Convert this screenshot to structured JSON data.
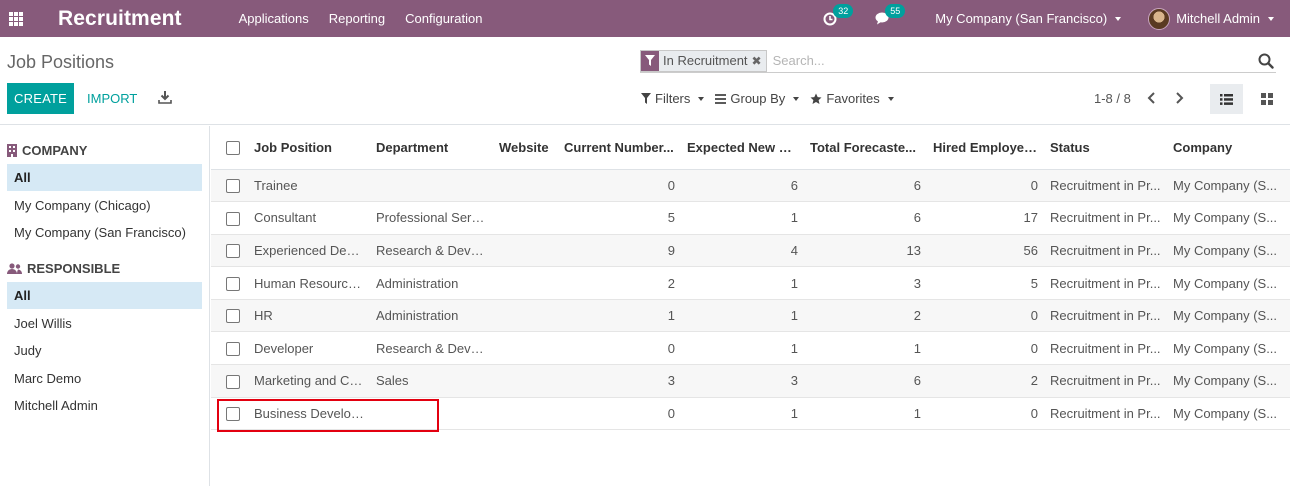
{
  "navbar": {
    "brand": "Recruitment",
    "menu": [
      "Applications",
      "Reporting",
      "Configuration"
    ],
    "activities_count": "32",
    "messages_count": "55",
    "company": "My Company (San Francisco)",
    "user": "Mitchell Admin"
  },
  "control": {
    "breadcrumb": "Job Positions",
    "facet": "In Recruitment",
    "search_placeholder": "Search...",
    "create_label": "CREATE",
    "import_label": "IMPORT",
    "filters_label": "Filters",
    "groupby_label": "Group By",
    "favorites_label": "Favorites",
    "pager": "1-8 / 8"
  },
  "sidebar": {
    "company_title": "COMPANY",
    "company_items": [
      "All",
      "My Company (Chicago)",
      "My Company (San Francisco)"
    ],
    "responsible_title": "RESPONSIBLE",
    "responsible_items": [
      "All",
      "Joel Willis",
      "Judy",
      "Marc Demo",
      "Mitchell Admin"
    ]
  },
  "table": {
    "headers": [
      "Job Position",
      "Department",
      "Website",
      "Current Number...",
      "Expected New E...",
      "Total Forecaste...",
      "Hired Employees",
      "Status",
      "Company"
    ],
    "rows": [
      [
        "Trainee",
        "",
        "",
        "0",
        "6",
        "6",
        "0",
        "Recruitment in Pr...",
        "My Company (S..."
      ],
      [
        "Consultant",
        "Professional Servi...",
        "",
        "5",
        "1",
        "6",
        "17",
        "Recruitment in Pr...",
        "My Company (S..."
      ],
      [
        "Experienced Deve...",
        "Research & Devel...",
        "",
        "9",
        "4",
        "13",
        "56",
        "Recruitment in Pr...",
        "My Company (S..."
      ],
      [
        "Human Resource...",
        "Administration",
        "",
        "2",
        "1",
        "3",
        "5",
        "Recruitment in Pr...",
        "My Company (S..."
      ],
      [
        "HR",
        "Administration",
        "",
        "1",
        "1",
        "2",
        "0",
        "Recruitment in Pr...",
        "My Company (S..."
      ],
      [
        "Developer",
        "Research & Devel...",
        "",
        "0",
        "1",
        "1",
        "0",
        "Recruitment in Pr...",
        "My Company (S..."
      ],
      [
        "Marketing and Co...",
        "Sales",
        "",
        "3",
        "3",
        "6",
        "2",
        "Recruitment in Pr...",
        "My Company (S..."
      ],
      [
        "Business Develop...",
        "",
        "",
        "0",
        "1",
        "1",
        "0",
        "Recruitment in Pr...",
        "My Company (S..."
      ]
    ]
  },
  "colors": {
    "brand": "#875a7b",
    "primary": "#00a09d",
    "highlight": "#e30010"
  }
}
